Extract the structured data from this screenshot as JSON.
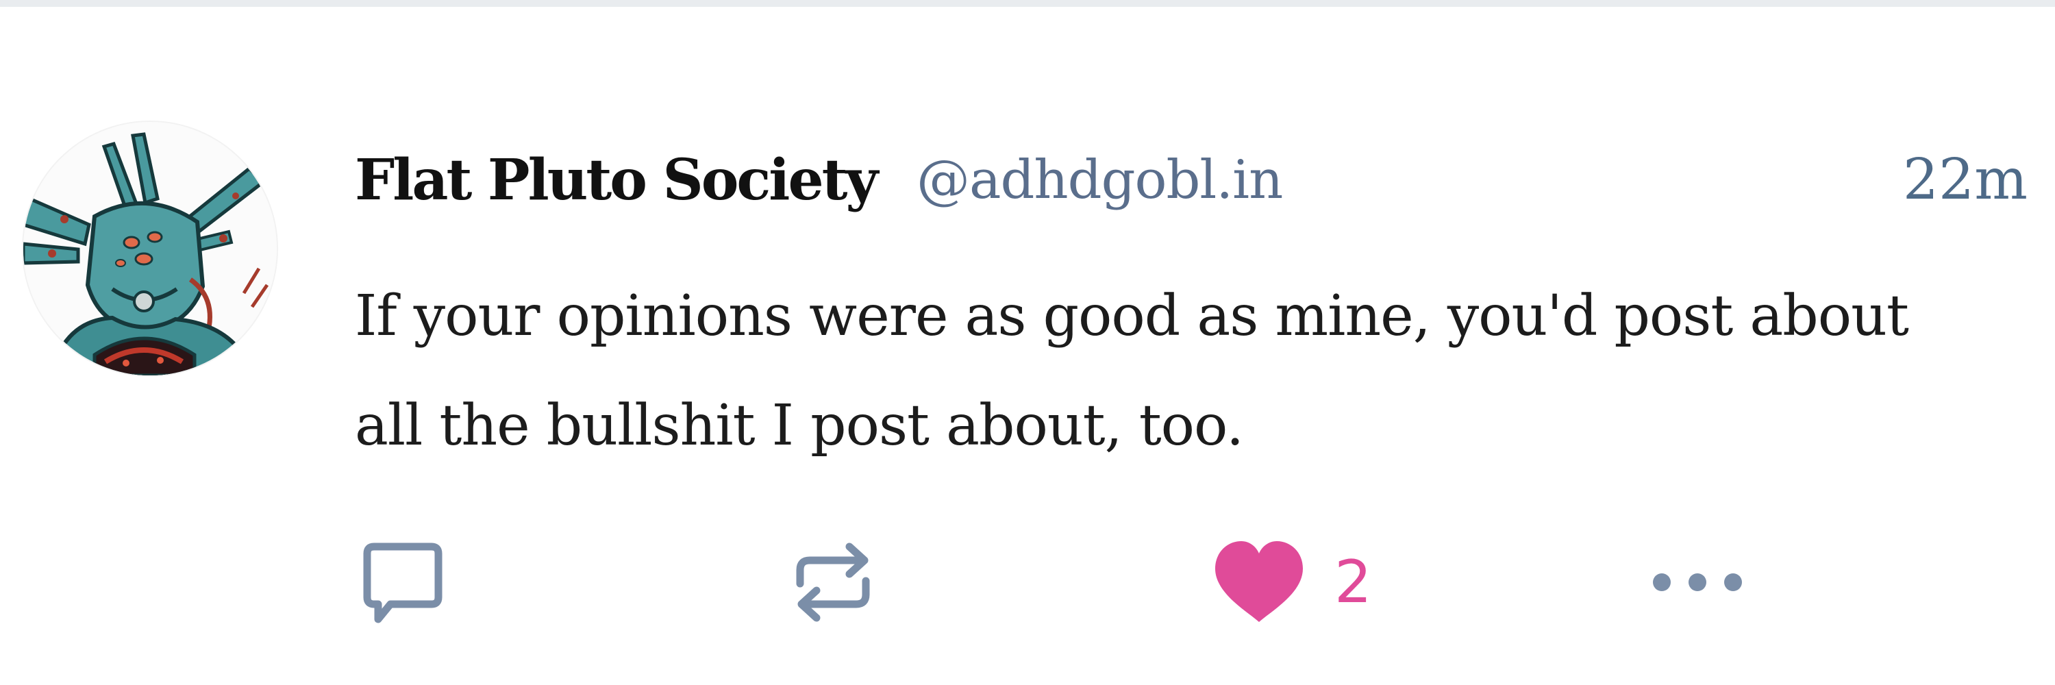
{
  "post": {
    "author": {
      "display_name": "Flat Pluto Society",
      "handle": "@adhdgobl.in"
    },
    "timestamp": "22m",
    "text": "If your opinions were as good as mine, you'd post about all the bullshit I post about, too.",
    "actions": {
      "reply_icon": "speech-bubble",
      "repost_icon": "repost-arrows",
      "like_icon": "heart-filled",
      "like_count": "2",
      "more_icon": "ellipsis-horizontal"
    }
  },
  "colors": {
    "accent_like": "#e04b99",
    "icon_muted": "#7b8ea8",
    "handle": "#5a6e8c",
    "text": "#1c1c1c"
  }
}
